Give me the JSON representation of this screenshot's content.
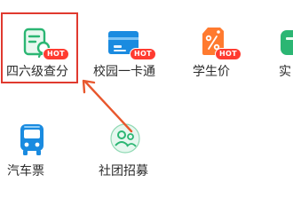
{
  "grid": {
    "items": [
      {
        "label": "四六级查分",
        "badge": "HOT",
        "icon": "score-certificate-icon"
      },
      {
        "label": "校园一卡通",
        "badge": "HOT",
        "icon": "campus-card-icon"
      },
      {
        "label": "学生价",
        "badge": "HOT",
        "icon": "discount-tag-icon"
      },
      {
        "label": "实",
        "badge": "",
        "icon": "partial-cut-off-icon"
      },
      {
        "label": "汽车票",
        "badge": "",
        "icon": "bus-icon"
      },
      {
        "label": "社团招募",
        "badge": "",
        "icon": "club-recruit-icon"
      }
    ]
  },
  "colors": {
    "accent_blue": "#1a8be0",
    "accent_orange": "#ff7a2f",
    "accent_green": "#2bb673",
    "badge_red": "#ff3b30",
    "highlight_red": "#e03a2f"
  }
}
